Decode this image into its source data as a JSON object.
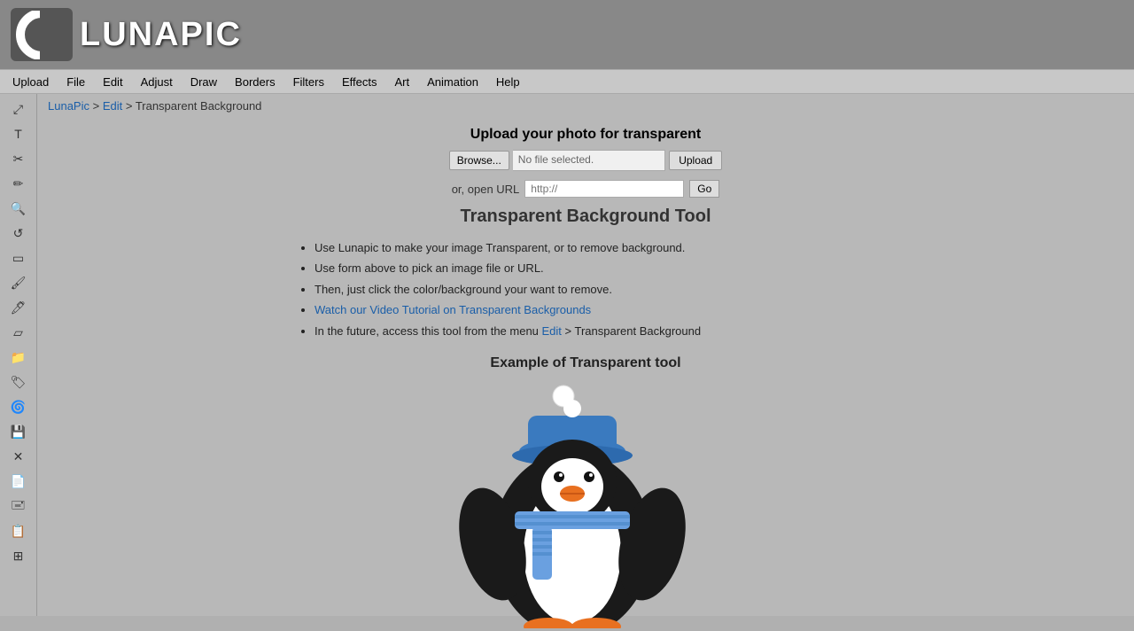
{
  "header": {
    "logo_text": "LUNAPIC"
  },
  "navbar": {
    "items": [
      {
        "label": "Upload",
        "id": "nav-upload"
      },
      {
        "label": "File",
        "id": "nav-file"
      },
      {
        "label": "Edit",
        "id": "nav-edit"
      },
      {
        "label": "Adjust",
        "id": "nav-adjust"
      },
      {
        "label": "Draw",
        "id": "nav-draw"
      },
      {
        "label": "Borders",
        "id": "nav-borders"
      },
      {
        "label": "Filters",
        "id": "nav-filters"
      },
      {
        "label": "Effects",
        "id": "nav-effects"
      },
      {
        "label": "Art",
        "id": "nav-art"
      },
      {
        "label": "Animation",
        "id": "nav-animation"
      },
      {
        "label": "Help",
        "id": "nav-help"
      }
    ]
  },
  "breadcrumb": {
    "home_label": "LunaPic",
    "separator1": " > ",
    "edit_label": "Edit",
    "separator2": " > ",
    "current": "Transparent Background"
  },
  "upload": {
    "title": "Upload your photo for transparent",
    "browse_label": "Browse...",
    "file_placeholder": "No file selected.",
    "upload_label": "Upload"
  },
  "url_section": {
    "label": "or, open URL",
    "placeholder": "http://",
    "go_label": "Go"
  },
  "tool": {
    "title": "Transparent Background Tool",
    "bullets": [
      "Use Lunapic to make your image Transparent, or to remove background.",
      "Use form above to pick an image file or URL.",
      "Then, just click the color/background your want to remove.",
      "Watch our Video Tutorial on Transparent Backgrounds",
      "In the future, access this tool from the menu Edit > Transparent Background"
    ],
    "video_link_text": "Watch our Video Tutorial on Transparent Backgrounds",
    "edit_link_text": "Edit"
  },
  "example": {
    "title": "Example of Transparent tool"
  },
  "sidebar": {
    "icons": [
      {
        "name": "move",
        "symbol": "⤢"
      },
      {
        "name": "text",
        "symbol": "T"
      },
      {
        "name": "scissors",
        "symbol": "✂"
      },
      {
        "name": "pencil",
        "symbol": "✏"
      },
      {
        "name": "zoom",
        "symbol": "🔍"
      },
      {
        "name": "rotate",
        "symbol": "↺"
      },
      {
        "name": "rectangle",
        "symbol": "▭"
      },
      {
        "name": "brush",
        "symbol": "🖌"
      },
      {
        "name": "eyedropper",
        "symbol": "💉"
      },
      {
        "name": "eraser",
        "symbol": "▱"
      },
      {
        "name": "folder",
        "symbol": "📁"
      },
      {
        "name": "tag",
        "symbol": "🏷"
      },
      {
        "name": "swirl",
        "symbol": "🌀"
      },
      {
        "name": "save",
        "symbol": "💾"
      },
      {
        "name": "close",
        "symbol": "✕"
      },
      {
        "name": "document",
        "symbol": "📄"
      },
      {
        "name": "stamp",
        "symbol": "🖃"
      },
      {
        "name": "copy",
        "symbol": "📋"
      },
      {
        "name": "layers",
        "symbol": "⊞"
      }
    ]
  }
}
